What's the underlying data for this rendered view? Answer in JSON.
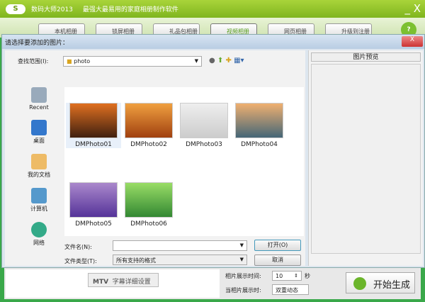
{
  "app": {
    "title": "数码大师2013",
    "subtitle": "最强大最易用的家庭相册制作软件",
    "minimize": "_",
    "close": "X"
  },
  "tabs": [
    "本机相册",
    "锁屏相册",
    "礼品包相册",
    "视频相册",
    "网页相册",
    "升级到注册"
  ],
  "help": "?",
  "dialog": {
    "title": "请选择要添加的图片：",
    "close": "X",
    "lookin_label": "查找范围(I):",
    "lookin_value": "photo",
    "places": [
      "Recent",
      "桌面",
      "我的文档",
      "计算机",
      "网络"
    ],
    "files": [
      "DMPhoto01",
      "DMPhoto02",
      "DMPhoto03",
      "DMPhoto04",
      "DMPhoto05",
      "DMPhoto06"
    ],
    "filename_label": "文件名(N):",
    "filename_value": "",
    "filetype_label": "文件类型(T):",
    "filetype_value": "所有支持的格式",
    "open": "打开(O)",
    "cancel": "取消",
    "preview_title": "图片预览"
  },
  "bottom": {
    "mtv_label": "MTV",
    "mtv_button": "字幕详细设置",
    "duration_label": "相片展示时间:",
    "duration_value": "10",
    "duration_unit": "秒",
    "effect_label": "当相片展示时:",
    "effect_value": "双重动态",
    "generate": "开始生成"
  }
}
